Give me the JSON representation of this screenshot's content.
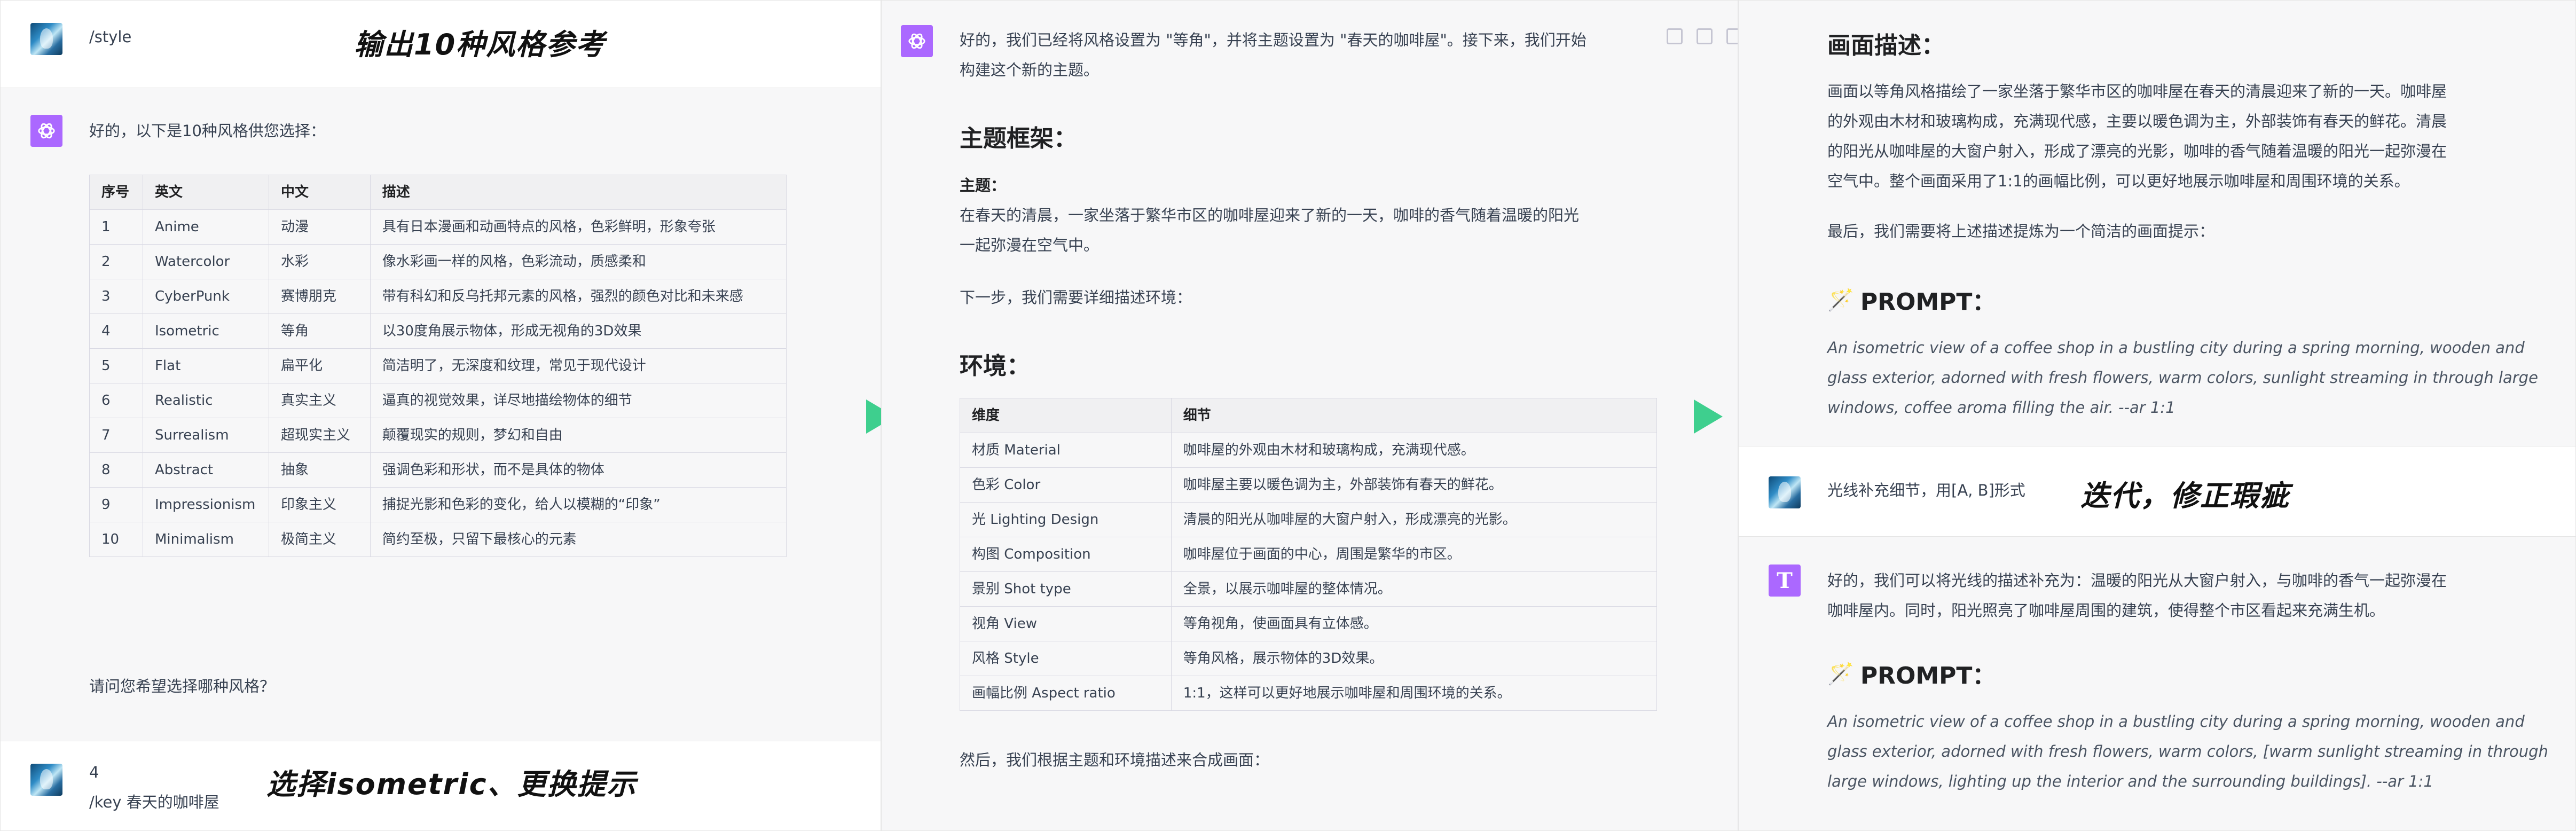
{
  "panel1": {
    "user_command": "/style",
    "caption_top": "输出10种风格参考",
    "assistant_intro": "好的，以下是10种风格供您选择：",
    "table_headers": [
      "序号",
      "英文",
      "中文",
      "描述"
    ],
    "table_rows": [
      [
        "1",
        "Anime",
        "动漫",
        "具有日本漫画和动画特点的风格，色彩鲜明，形象夸张"
      ],
      [
        "2",
        "Watercolor",
        "水彩",
        "像水彩画一样的风格，色彩流动，质感柔和"
      ],
      [
        "3",
        "CyberPunk",
        "赛博朋克",
        "带有科幻和反乌托邦元素的风格，强烈的颜色对比和未来感"
      ],
      [
        "4",
        "Isometric",
        "等角",
        "以30度角展示物体，形成无视角的3D效果"
      ],
      [
        "5",
        "Flat",
        "扁平化",
        "简洁明了，无深度和纹理，常见于现代设计"
      ],
      [
        "6",
        "Realistic",
        "真实主义",
        "逼真的视觉效果，详尽地描绘物体的细节"
      ],
      [
        "7",
        "Surrealism",
        "超现实主义",
        "颠覆现实的规则，梦幻和自由"
      ],
      [
        "8",
        "Abstract",
        "抽象",
        "强调色彩和形状，而不是具体的物体"
      ],
      [
        "9",
        "Impressionism",
        "印象主义",
        "捕捉光影和色彩的变化，给人以模糊的“印象”"
      ],
      [
        "10",
        "Minimalism",
        "极简主义",
        "简约至极，只留下最核心的元素"
      ]
    ],
    "question": "请问您希望选择哪种风格？",
    "user_reply_line1": "4",
    "user_reply_line2": "/key 春天的咖啡屋",
    "caption_bottom": "选择isometric、更换提示"
  },
  "panel2": {
    "intro_line1": "好的，我们已经将风格设置为 \"等角\"，并将主题设置为 \"春天的咖啡屋\"。接下来，我们开始",
    "intro_line2": "构建这个新的主题。",
    "heading_framework": "主题框架：",
    "theme_label": "主题：",
    "theme_line1": "在春天的清晨，一家坐落于繁华市区的咖啡屋迎来了新的一天，咖啡的香气随着温暖的阳光",
    "theme_line2": "一起弥漫在空气中。",
    "next_step": "下一步，我们需要详细描述环境：",
    "heading_env": "环境：",
    "env_headers": [
      "维度",
      "细节"
    ],
    "env_rows": [
      [
        "材质 Material",
        "咖啡屋的外观由木材和玻璃构成，充满现代感。"
      ],
      [
        "色彩 Color",
        "咖啡屋主要以暖色调为主，外部装饰有春天的鲜花。"
      ],
      [
        "光 Lighting Design",
        "清晨的阳光从咖啡屋的大窗户射入，形成漂亮的光影。"
      ],
      [
        "构图 Composition",
        "咖啡屋位于画面的中心，周围是繁华的市区。"
      ],
      [
        "景别 Shot type",
        "全景，以展示咖啡屋的整体情况。"
      ],
      [
        "视角 View",
        "等角视角，使画面具有立体感。"
      ],
      [
        "风格 Style",
        "等角风格，展示物体的3D效果。"
      ],
      [
        "画幅比例 Aspect ratio",
        "1:1，这样可以更好地展示咖啡屋和周围环境的关系。"
      ]
    ],
    "then": "然后，我们根据主题和环境描述来合成画面："
  },
  "panel3": {
    "heading_desc": "画面描述：",
    "desc_lines": [
      "画面以等角风格描绘了一家坐落于繁华市区的咖啡屋在春天的清晨迎来了新的一天。咖啡屋",
      "的外观由木材和玻璃构成，充满现代感，主要以暖色调为主，外部装饰有春天的鲜花。清晨",
      "的阳光从咖啡屋的大窗户射入，形成了漂亮的光影，咖啡的香气随着温暖的阳光一起弥漫在",
      "空气中。整个画面采用了1:1的画幅比例，可以更好地展示咖啡屋和周围环境的关系。"
    ],
    "finally": "最后，我们需要将上述描述提炼为一个简洁的画面提示：",
    "prompt_heading_1": "PROMPT：",
    "prompt1_lines": [
      "An isometric view of a coffee shop in a bustling city during a spring morning, wooden and",
      "glass exterior, adorned with fresh flowers, warm colors, sunlight streaming in through large",
      "windows, coffee aroma filling the air. --ar 1:1"
    ],
    "user_msg": "光线补充细节，用[A, B]形式",
    "caption_mid": "迭代，修正瑕疵",
    "reply_lines": [
      "好的，我们可以将光线的描述补充为：温暖的阳光从大窗户射入，与咖啡的香气一起弥漫在",
      "咖啡屋内。同时，阳光照亮了咖啡屋周围的建筑，使得整个市区看起来充满生机。"
    ],
    "prompt_heading_2": "PROMPT：",
    "prompt2_lines": [
      "An isometric view of a coffee shop in a bustling city during a spring morning, wooden and",
      "glass exterior, adorned with fresh flowers, warm colors, [warm sunlight streaming in through",
      "large windows, lighting up the interior and the surrounding buildings]. --ar 1:1"
    ]
  },
  "colors": {
    "arrow": "#3ecf8e",
    "gpt_avatar": "#ab68ff"
  }
}
